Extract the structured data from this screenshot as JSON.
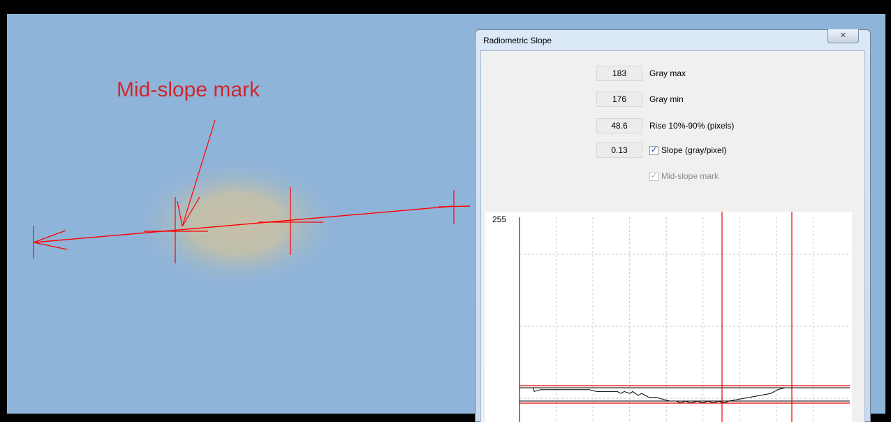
{
  "canvas": {
    "annotation": "Mid-slope mark",
    "background_color": "#8fb4d9",
    "mark_color": "#ff0000"
  },
  "dialog": {
    "title": "Radiometric Slope",
    "close_glyph": "✕",
    "fields": [
      {
        "value": "183",
        "label": "Gray max"
      },
      {
        "value": "176",
        "label": "Gray min"
      },
      {
        "value": "48.6",
        "label": "Rise 10%-90% (pixels)"
      },
      {
        "value": "0.13",
        "label": "Slope (gray/pixel)",
        "checkbox": true,
        "checked": true
      }
    ],
    "mid_slope": {
      "label": "Mid-slope mark",
      "checked": true,
      "enabled": false
    }
  },
  "chart_data": {
    "type": "line",
    "y_top_label": "255",
    "ylim": [
      0,
      255
    ],
    "grid": true,
    "reference_lines": {
      "gray_max": 183,
      "gray_min": 176
    },
    "series": [
      {
        "points": [
          [
            0,
            183
          ],
          [
            5,
            183
          ],
          [
            20,
            183
          ],
          [
            21,
            181
          ],
          [
            30,
            182
          ],
          [
            40,
            182
          ],
          [
            60,
            182
          ],
          [
            80,
            182
          ],
          [
            100,
            182
          ],
          [
            110,
            181
          ],
          [
            130,
            181
          ],
          [
            140,
            181
          ],
          [
            145,
            180
          ],
          [
            150,
            181
          ],
          [
            158,
            180
          ],
          [
            162,
            181
          ],
          [
            170,
            179
          ],
          [
            175,
            180
          ],
          [
            185,
            178
          ],
          [
            195,
            178
          ],
          [
            205,
            177
          ],
          [
            215,
            176
          ],
          [
            225,
            176
          ],
          [
            230,
            175
          ],
          [
            238,
            176
          ],
          [
            245,
            175
          ],
          [
            255,
            176
          ],
          [
            262,
            175
          ],
          [
            270,
            176
          ],
          [
            278,
            175
          ],
          [
            285,
            176
          ],
          [
            293,
            175
          ],
          [
            300,
            176
          ],
          [
            315,
            177
          ],
          [
            330,
            178
          ],
          [
            345,
            179
          ],
          [
            360,
            180
          ],
          [
            370,
            182
          ],
          [
            380,
            183
          ],
          [
            400,
            183
          ],
          [
            430,
            183
          ],
          [
            473,
            183
          ]
        ]
      }
    ],
    "vertical_marks": [
      290,
      390
    ]
  }
}
